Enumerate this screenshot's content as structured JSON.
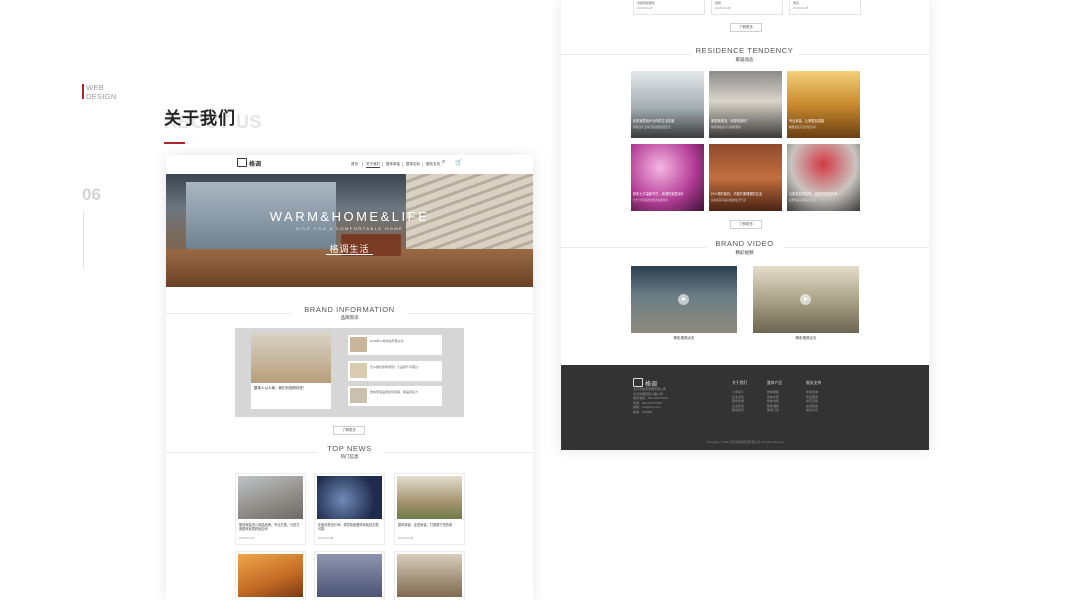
{
  "slide": {
    "tag_line1": "WEB",
    "tag_line2": "DESIGN",
    "number": "06",
    "title_cn": "关于我们",
    "title_en": "ABOUT US"
  },
  "site": {
    "logo": "格调",
    "nav": [
      "首页",
      "关于我们",
      "整体家装",
      "整体定制",
      "服务支持"
    ],
    "hero": {
      "heading": "WARM&HOME&LIFE",
      "sub": "GIVE YOU A COMFORTABLE HOME",
      "cn": "格调生活"
    },
    "brand": {
      "en": "BRAND INFORMATION",
      "cn": "品牌资讯",
      "feature_title": "整体人以人家，我们为您而存在！",
      "rows": [
        "2018年xx城市站开幕仪式",
        "怎么做好整体家装？大品牌不可错过",
        "整体家装品牌如何选择，看品牌实力"
      ],
      "more": "了解更多"
    },
    "news": {
      "en": "TOP NEWS",
      "cn": "热门信息",
      "items": [
        {
          "title": "整体家装怎么挑选品牌，专业打造，为您打造整体家居舒适空间",
          "date": "2018-02-06"
        },
        {
          "title": "年度优秀设计师，带您探索整体家装的无限可能",
          "date": "2018-02-08"
        },
        {
          "title": "整体家装：走进家装，打造属于您的家",
          "date": "2018-02-06"
        }
      ]
    },
    "residence": {
      "en": "RESIDENCE TENDENCY",
      "cn": "家居动态",
      "items": [
        {
          "title": "走进家居设计与你的生活态度",
          "desc": "家居设计让你打造温馨家居生活"
        },
        {
          "title": "家居新潮流，你能知道吗？",
          "desc": "简约风格设计引领新潮流"
        },
        {
          "title": "专业家装，让家更加温馨",
          "desc": "精致家装打造舒适空间"
        },
        {
          "title": "精彩七夕温馨节日，浪漫的家居设计",
          "desc": "七夕节日家装优惠活动进行中"
        },
        {
          "title": "什么样的家具，才能打造理想的生活",
          "desc": "实木家具带来自然的生活气息"
        },
        {
          "title": "让家具变成装饰，温馨的家居情调",
          "desc": "家居饰品点缀美好生活"
        }
      ],
      "more": "了解更多"
    },
    "video": {
      "en": "BRAND VIDEO",
      "cn": "精彩视频",
      "captions": [
        "精彩视频点击",
        "精彩视频点击"
      ]
    },
    "top_cards": [
      {
        "title": "优质家装服务",
        "date": "2018-02-08"
      },
      {
        "title": "家装",
        "date": "2018-02-08"
      },
      {
        "title": "家具",
        "date": "2018-02-08"
      }
    ],
    "top_more": "了解更多",
    "footer": {
      "logo": "格调",
      "company": [
        "北京市格调家居有限公司",
        "北京市朝阳区xx路xx号",
        "联系电话：010-XXXXXXX",
        "传真：010-XXXXXXX",
        "邮箱：xxx@xxx.com",
        "邮编：100000"
      ],
      "cols": [
        {
          "head": "关于我们",
          "items": [
            "公司简介",
            "企业文化",
            "荣誉资质",
            "企业新闻",
            "联系我们"
          ]
        },
        {
          "head": "整体产品",
          "items": [
            "整体厨柜",
            "整体衣柜",
            "整体书柜",
            "整体酒柜",
            "整体门窗"
          ]
        },
        {
          "head": "服务支持",
          "items": [
            "售前咨询",
            "售后服务",
            "常见问题",
            "在线留言",
            "联系方式"
          ]
        }
      ],
      "copyright": "Copyright © 2018 北京市格调家居有限公司 All rights reserved"
    }
  }
}
